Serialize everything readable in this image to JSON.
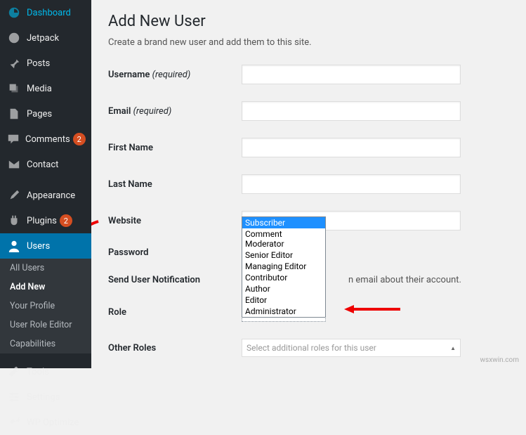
{
  "sidebar": {
    "items": [
      {
        "label": "Dashboard"
      },
      {
        "label": "Jetpack"
      },
      {
        "label": "Posts"
      },
      {
        "label": "Media"
      },
      {
        "label": "Pages"
      },
      {
        "label": "Comments",
        "badge": "2"
      },
      {
        "label": "Contact"
      },
      {
        "label": "Appearance"
      },
      {
        "label": "Plugins",
        "badge": "2"
      },
      {
        "label": "Users"
      },
      {
        "label": "Tools"
      },
      {
        "label": "Settings"
      },
      {
        "label": "WP Optimize"
      }
    ],
    "submenu": [
      {
        "label": "All Users"
      },
      {
        "label": "Add New"
      },
      {
        "label": "Your Profile"
      },
      {
        "label": "User Role Editor"
      },
      {
        "label": "Capabilities"
      }
    ]
  },
  "main": {
    "title": "Add New User",
    "subtitle": "Create a brand new user and add them to this site.",
    "fields": {
      "username_label": "Username",
      "username_req": " (required)",
      "email_label": "Email",
      "email_req": " (required)",
      "firstname_label": "First Name",
      "lastname_label": "Last Name",
      "website_label": "Website",
      "password_label": "Password",
      "notification_label": "Send User Notification",
      "notification_text": "n email about their account.",
      "role_label": "Role",
      "role_value": "Subscriber",
      "otherroles_label": "Other Roles",
      "otherroles_placeholder": "Select additional roles for this user"
    },
    "role_options": [
      "Subscriber",
      "Comment Moderator",
      "Senior Editor",
      "Managing Editor",
      "Contributor",
      "Author",
      "Editor",
      "Administrator"
    ]
  },
  "watermark": "wsxwin.com"
}
